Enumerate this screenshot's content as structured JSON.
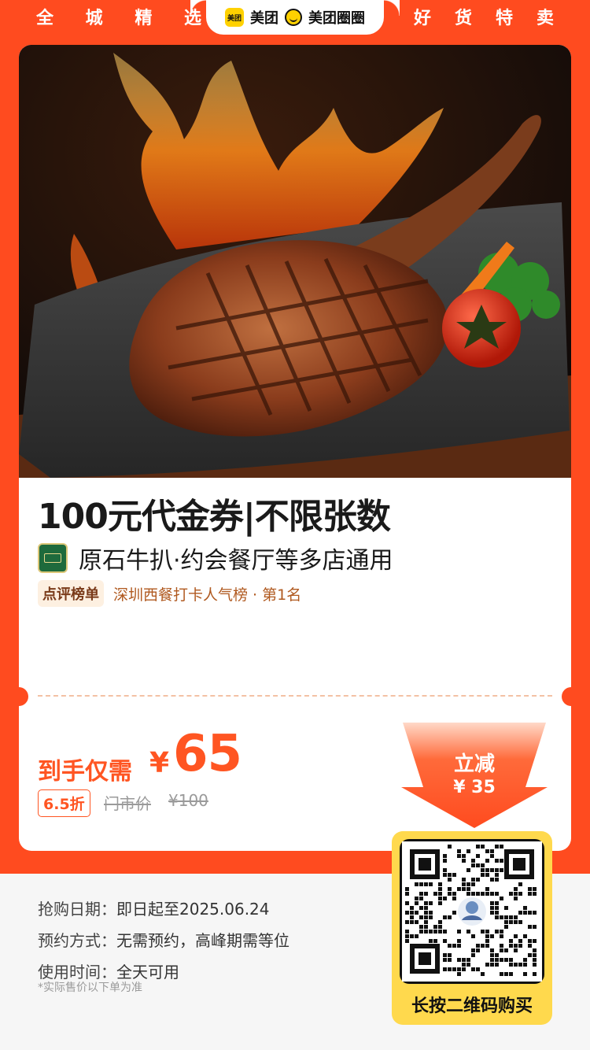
{
  "top_bar": {
    "slogan_left": [
      "全",
      "城",
      "精",
      "选"
    ],
    "slogan_right": [
      "好",
      "货",
      "特",
      "卖"
    ],
    "brand_meituan": "美团",
    "brand_quanquan": "美团圈圈",
    "logo_mark_text": "美团"
  },
  "product": {
    "title": "100元代金券|不限张数",
    "shop": "原石牛扒·约会餐厅等多店通用",
    "rank_badge": "点评榜单",
    "rank_text": "深圳西餐打卡人气榜 · 第1名"
  },
  "price": {
    "label": "到手仅需",
    "symbol": "¥",
    "value": "65",
    "discount": "6.5折",
    "original_label": "门市价",
    "original_value": "¥100"
  },
  "savings": {
    "title": "立减",
    "amount": "¥ 35"
  },
  "info": {
    "rows": [
      {
        "key": "抢购日期：",
        "value": "即日起至2025.06.24"
      },
      {
        "key": "预约方式：",
        "value": "无需预约，高峰期需等位"
      },
      {
        "key": "使用时间：",
        "value": "全天可用"
      }
    ],
    "note": "*实际售价以下单为准"
  },
  "qr": {
    "cta": "长按二维码购买"
  },
  "colors": {
    "brand_orange": "#ff4b1f",
    "price_orange": "#ff5522",
    "qr_yellow": "#ffd94d"
  }
}
